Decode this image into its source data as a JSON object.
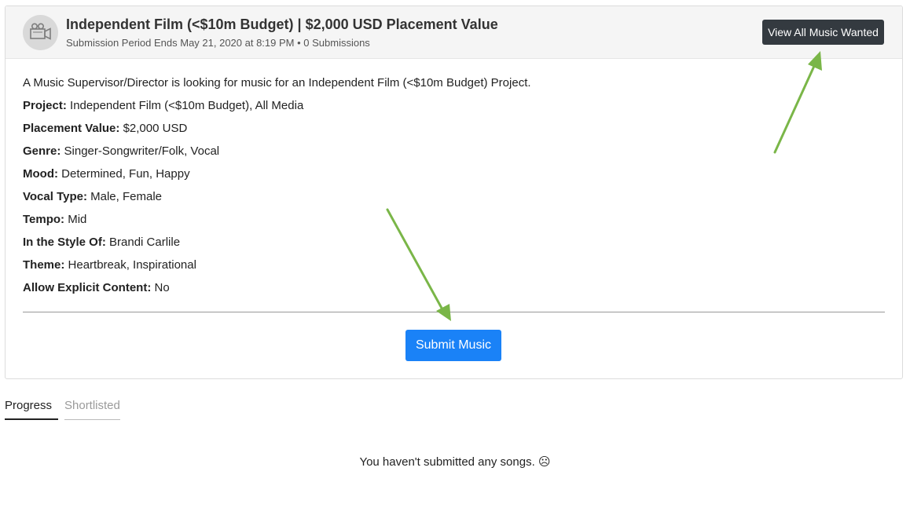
{
  "listing": {
    "avatar_icon": "film-camera-icon",
    "title": "Independent Film (<$10m Budget) | $2,000 USD Placement Value",
    "subtitle": "Submission Period Ends May 21, 2020 at 8:19 PM • 0 Submissions",
    "view_all_label": "View All Music Wanted",
    "intro": "A Music Supervisor/Director is looking for music for an Independent Film (<$10m Budget) Project.",
    "fields": [
      {
        "label": "Project:",
        "value": "Independent Film (<$10m Budget), All Media"
      },
      {
        "label": "Placement Value:",
        "value": "$2,000 USD"
      },
      {
        "label": "Genre:",
        "value": "Singer-Songwriter/Folk, Vocal"
      },
      {
        "label": "Mood:",
        "value": "Determined, Fun, Happy"
      },
      {
        "label": "Vocal Type:",
        "value": "Male, Female"
      },
      {
        "label": "Tempo:",
        "value": "Mid"
      },
      {
        "label": "In the Style Of:",
        "value": "Brandi Carlile"
      },
      {
        "label": "Theme:",
        "value": "Heartbreak, Inspirational"
      },
      {
        "label": "Allow Explicit Content:",
        "value": "No"
      }
    ],
    "submit_label": "Submit Music"
  },
  "tabs": [
    {
      "label": "Progress",
      "active": true
    },
    {
      "label": "Shortlisted",
      "active": false
    }
  ],
  "empty_message": "You haven't submitted any songs. ☹",
  "colors": {
    "primary_button": "#1a82f7",
    "dark_button": "#343a40",
    "annotation_arrow": "#7ab648",
    "header_bg": "#f5f5f5"
  }
}
